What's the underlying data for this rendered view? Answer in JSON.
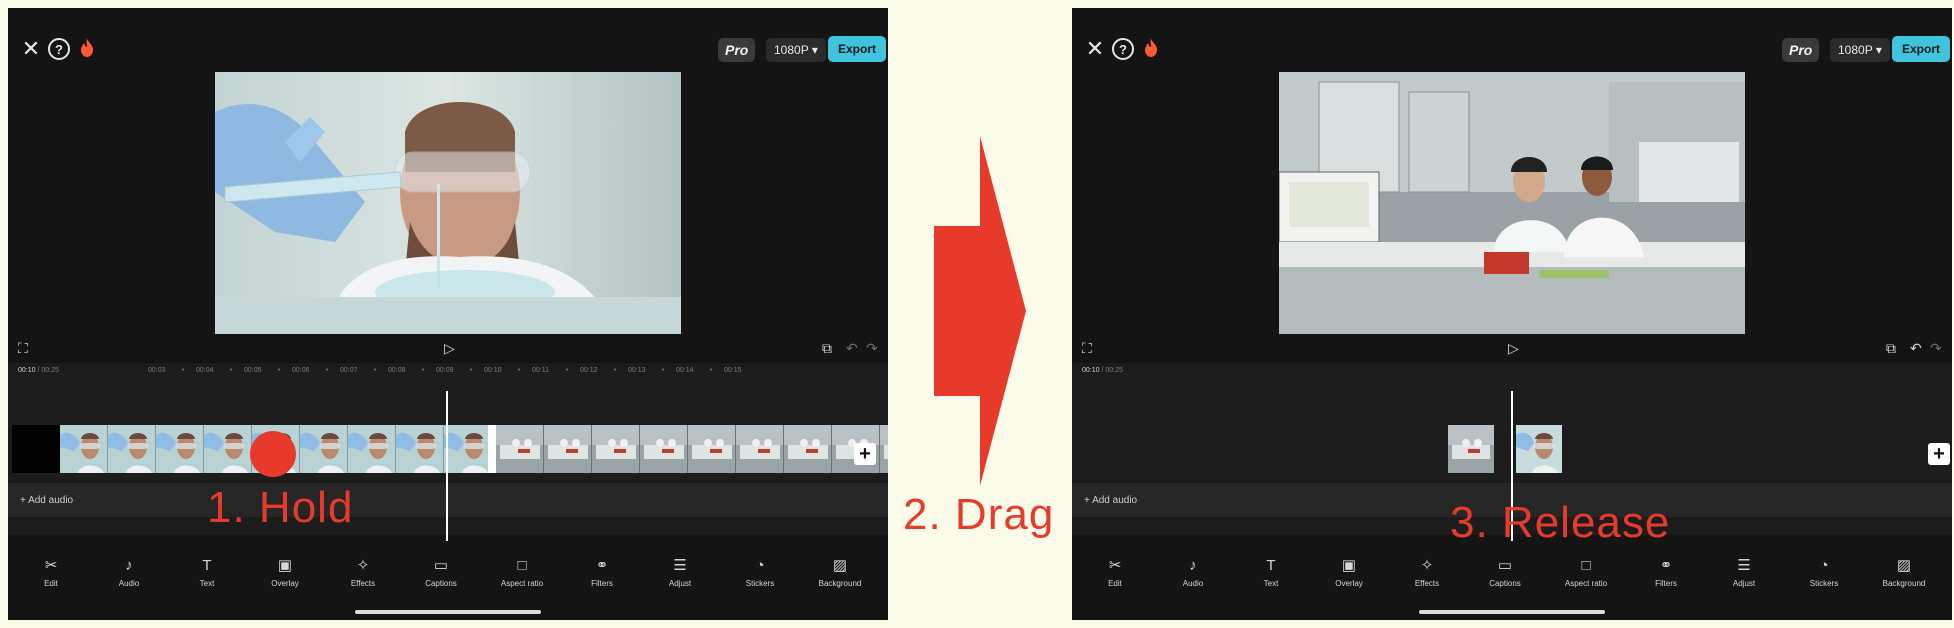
{
  "left_panel": {
    "pro": "Pro",
    "resolution": "1080P",
    "export": "Export",
    "time_current": "00:10",
    "time_total": "00:25",
    "ruler": [
      "00:03",
      "•",
      "00:04",
      "•",
      "00:05",
      "•",
      "00:06",
      "•",
      "00:07",
      "•",
      "00:08",
      "•",
      "00:09",
      "•",
      "00:10",
      "•",
      "00:11",
      "•",
      "00:12",
      "•",
      "00:13",
      "•",
      "00:14",
      "•",
      "00:15"
    ],
    "add_audio": "+ Add audio"
  },
  "right_panel": {
    "pro": "Pro",
    "resolution": "1080P",
    "export": "Export",
    "time_current": "00:10",
    "time_total": "00:25",
    "add_audio": "+ Add audio"
  },
  "toolbar": [
    "Edit",
    "Audio",
    "Text",
    "Overlay",
    "Effects",
    "Captions",
    "Aspect ratio",
    "Filters",
    "Adjust",
    "Stickers",
    "Background"
  ],
  "steps": {
    "hold": "1. Hold",
    "drag": "2. Drag",
    "release": "3. Release"
  },
  "colors": {
    "accent": "#40c4de",
    "annotation": "#e83a2a",
    "panel_bg": "#141414",
    "page_bg": "#fbfbea"
  }
}
